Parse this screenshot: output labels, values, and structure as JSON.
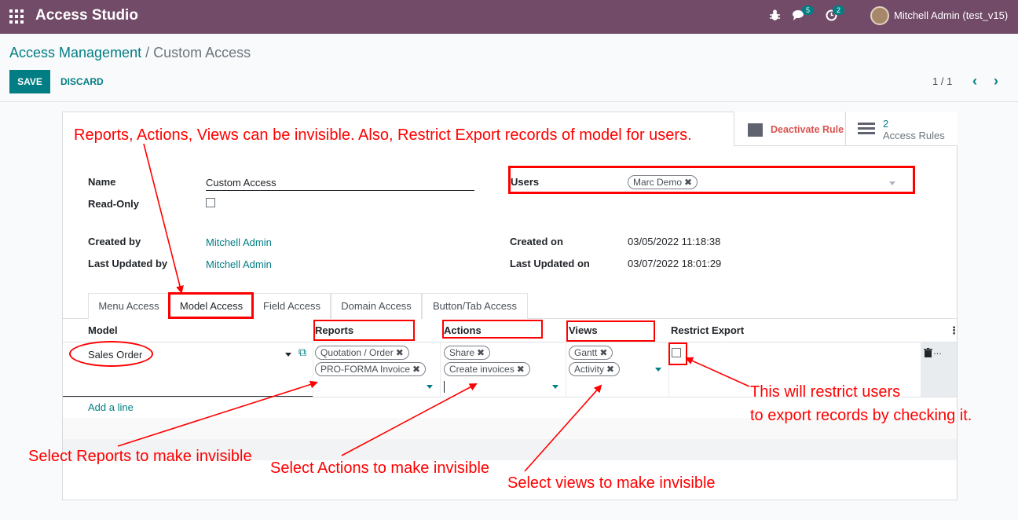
{
  "app": {
    "title": "Access Studio"
  },
  "nav": {
    "messages_badge": "5",
    "activity_badge": "2",
    "user_name": "Mitchell Admin (test_v15)"
  },
  "breadcrumb": {
    "parent": "Access Management",
    "separator": "/",
    "current": "Custom Access"
  },
  "buttons": {
    "save": "SAVE",
    "discard": "DISCARD"
  },
  "pager": {
    "value": "1 / 1"
  },
  "stat_buttons": {
    "deactivate": "Deactivate Rule",
    "rules_count": "2",
    "rules_label": "Access Rules"
  },
  "form": {
    "name_label": "Name",
    "name_value": "Custom Access",
    "readonly_label": "Read-Only",
    "readonly_checked": false,
    "users_label": "Users",
    "users_tags": [
      "Marc Demo"
    ],
    "created_by_label": "Created by",
    "created_by": "Mitchell Admin",
    "last_updated_by_label": "Last Updated by",
    "last_updated_by": "Mitchell Admin",
    "created_on_label": "Created on",
    "created_on": "03/05/2022 11:18:38",
    "last_updated_on_label": "Last Updated on",
    "last_updated_on": "03/07/2022 18:01:29"
  },
  "tabs": [
    "Menu Access",
    "Model Access",
    "Field Access",
    "Domain Access",
    "Button/Tab Access"
  ],
  "active_tab": "Model Access",
  "table": {
    "headers": [
      "Model",
      "Reports",
      "Actions",
      "Views",
      "Restrict Export"
    ],
    "row": {
      "model": "Sales Order",
      "reports": [
        "Quotation / Order",
        "PRO-FORMA Invoice"
      ],
      "actions": [
        "Share",
        "Create invoices"
      ],
      "views": [
        "Gantt",
        "Activity"
      ],
      "restrict_export": false
    },
    "add_line": "Add a line"
  },
  "annotations": {
    "top": "Reports, Actions, Views can be invisible. Also, Restrict Export records of model for users.",
    "reports": "Select Reports to make invisible",
    "actions": "Select Actions to make invisible",
    "views": "Select views to make invisible",
    "restrict_line1": "This will restrict users",
    "restrict_line2": "to export records by checking it."
  },
  "colors": {
    "brand": "#714B67",
    "accent": "#017e84",
    "annotation": "#ff0000"
  }
}
